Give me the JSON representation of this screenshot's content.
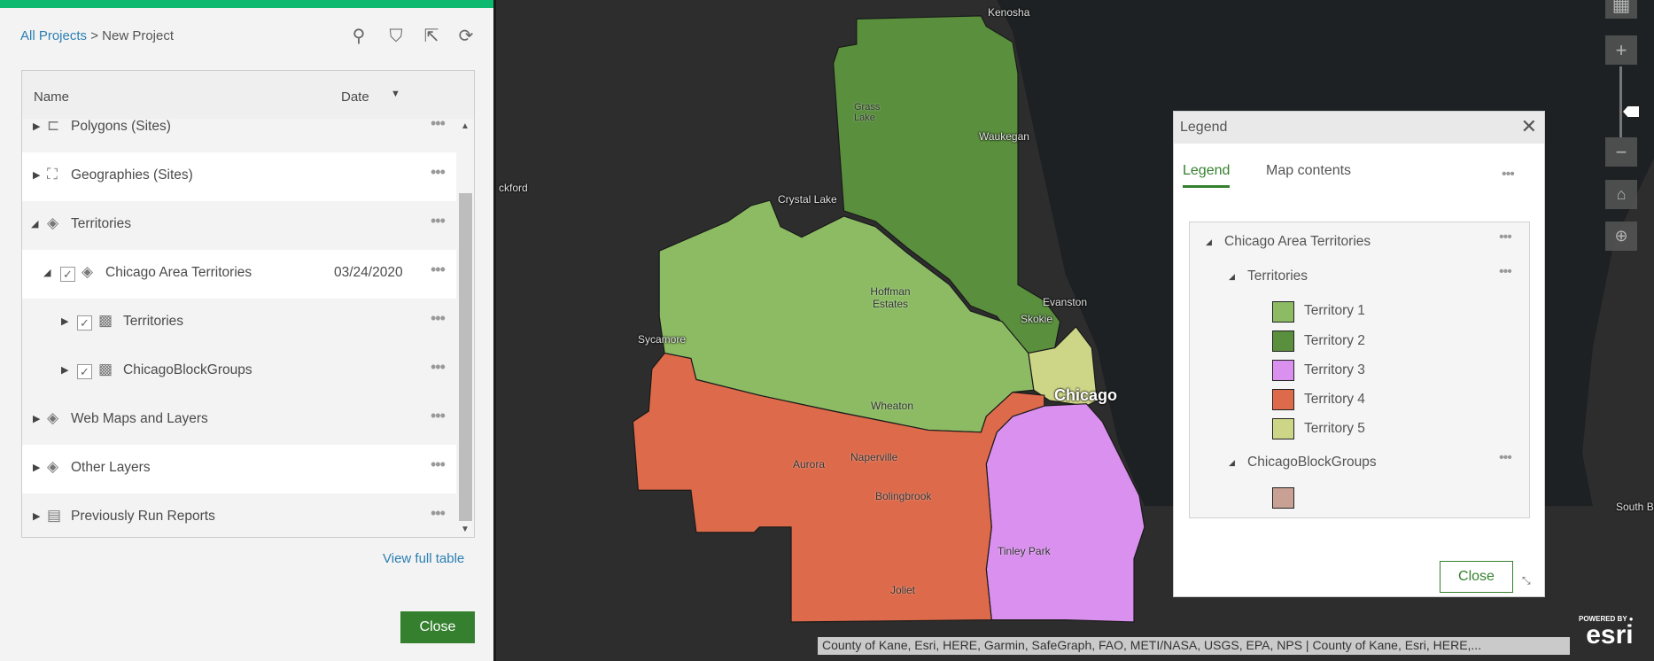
{
  "left_panel": {
    "breadcrumb": {
      "root": "All Projects",
      "sep": " > ",
      "current": "New Project"
    },
    "tools": {
      "search": "search-icon",
      "filter": "filter-icon",
      "export": "export-icon",
      "refresh": "refresh-icon"
    },
    "columns": {
      "name": "Name",
      "date": "Date"
    },
    "rows": [
      {
        "label": "Polygons (Sites)",
        "date": ""
      },
      {
        "label": "Geographies (Sites)",
        "date": ""
      },
      {
        "label": "Territories",
        "date": ""
      },
      {
        "label": "Chicago Area Territories",
        "date": "03/24/2020"
      },
      {
        "label": "Territories",
        "date": ""
      },
      {
        "label": "ChicagoBlockGroups",
        "date": ""
      },
      {
        "label": "Web Maps and Layers",
        "date": ""
      },
      {
        "label": "Other Layers",
        "date": ""
      },
      {
        "label": "Previously Run Reports",
        "date": ""
      }
    ],
    "view_full_table": "View full table",
    "close": "Close"
  },
  "map": {
    "labels": [
      "Kenosha",
      "Grass Lake",
      "Waukegan",
      "ckford",
      "Crystal Lake",
      "Hoffman Estates",
      "Evanston",
      "Skokie",
      "Sycamore",
      "Chicago",
      "Wheaton",
      "Aurora",
      "Naperville",
      "Bolingbrook",
      "Tinley Park",
      "Joliet",
      "South Bend"
    ],
    "attribution": "County of Kane, Esri, HERE, Garmin, SafeGraph, FAO, METI/NASA, USGS, EPA, NPS | County of Kane, Esri, HERE,...",
    "logo": {
      "powered": "POWERED BY",
      "brand": "esri"
    }
  },
  "legend": {
    "title": "Legend",
    "tabs": [
      "Legend",
      "Map contents"
    ],
    "active_tab": "Legend",
    "group": "Chicago Area Territories",
    "layer1": "Territories",
    "items": [
      {
        "label": "Territory 1",
        "color": "#8cbb64"
      },
      {
        "label": "Territory 2",
        "color": "#5a8f3e"
      },
      {
        "label": "Territory 3",
        "color": "#da90ee"
      },
      {
        "label": "Territory 4",
        "color": "#dd6a4a"
      },
      {
        "label": "Territory 5",
        "color": "#cdd586"
      }
    ],
    "layer2": "ChicagoBlockGroups",
    "layer2_color": "#c8a094",
    "close": "Close"
  }
}
